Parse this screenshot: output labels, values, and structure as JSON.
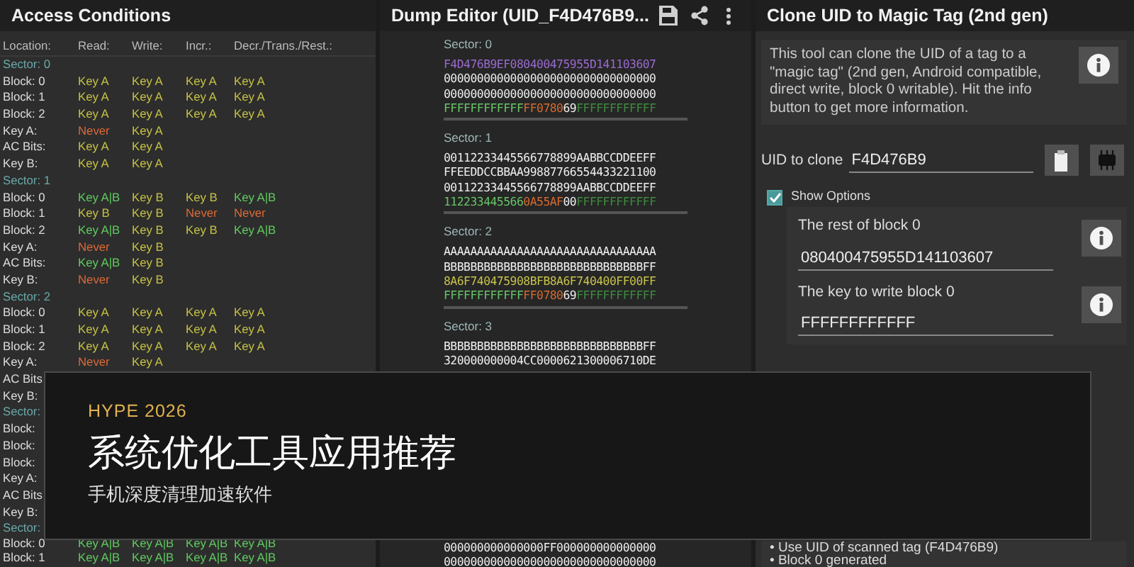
{
  "access_conditions": {
    "title": "Access Conditions",
    "columns": [
      "Location:",
      "Read:",
      "Write:",
      "Incr.:",
      "Decr./Trans./Rest.:"
    ],
    "sectors": [
      {
        "label": "Sector: 0",
        "rows": [
          {
            "label": "Block: 0",
            "cells": [
              {
                "text": "Key A",
                "kind": "single"
              },
              {
                "text": "Key A",
                "kind": "single"
              },
              {
                "text": "Key A",
                "kind": "single"
              },
              {
                "text": "Key A",
                "kind": "single"
              }
            ]
          },
          {
            "label": "Block: 1",
            "cells": [
              {
                "text": "Key A",
                "kind": "single"
              },
              {
                "text": "Key A",
                "kind": "single"
              },
              {
                "text": "Key A",
                "kind": "single"
              },
              {
                "text": "Key A",
                "kind": "single"
              }
            ]
          },
          {
            "label": "Block: 2",
            "cells": [
              {
                "text": "Key A",
                "kind": "single"
              },
              {
                "text": "Key A",
                "kind": "single"
              },
              {
                "text": "Key A",
                "kind": "single"
              },
              {
                "text": "Key A",
                "kind": "single"
              }
            ]
          },
          {
            "label": "Key A:",
            "cells": [
              {
                "text": "Never",
                "kind": "never"
              },
              {
                "text": "Key A",
                "kind": "single"
              }
            ]
          },
          {
            "label": "AC Bits:",
            "cells": [
              {
                "text": "Key A",
                "kind": "single"
              },
              {
                "text": "Key A",
                "kind": "single"
              }
            ]
          },
          {
            "label": "Key B:",
            "cells": [
              {
                "text": "Key A",
                "kind": "single"
              },
              {
                "text": "Key A",
                "kind": "single"
              }
            ]
          }
        ]
      },
      {
        "label": "Sector: 1",
        "rows": [
          {
            "label": "Block: 0",
            "cells": [
              {
                "text": "Key A|B",
                "kind": "both"
              },
              {
                "text": "Key B",
                "kind": "single"
              },
              {
                "text": "Key B",
                "kind": "single"
              },
              {
                "text": "Key A|B",
                "kind": "both"
              }
            ]
          },
          {
            "label": "Block: 1",
            "cells": [
              {
                "text": "Key B",
                "kind": "single"
              },
              {
                "text": "Key B",
                "kind": "single"
              },
              {
                "text": "Never",
                "kind": "never"
              },
              {
                "text": "Never",
                "kind": "never"
              }
            ]
          },
          {
            "label": "Block: 2",
            "cells": [
              {
                "text": "Key A|B",
                "kind": "both"
              },
              {
                "text": "Key B",
                "kind": "single"
              },
              {
                "text": "Key B",
                "kind": "single"
              },
              {
                "text": "Key A|B",
                "kind": "both"
              }
            ]
          },
          {
            "label": "Key A:",
            "cells": [
              {
                "text": "Never",
                "kind": "never"
              },
              {
                "text": "Key B",
                "kind": "single"
              }
            ]
          },
          {
            "label": "AC Bits:",
            "cells": [
              {
                "text": "Key A|B",
                "kind": "both"
              },
              {
                "text": "Key B",
                "kind": "single"
              }
            ]
          },
          {
            "label": "Key B:",
            "cells": [
              {
                "text": "Never",
                "kind": "never"
              },
              {
                "text": "Key B",
                "kind": "single"
              }
            ]
          }
        ]
      },
      {
        "label": "Sector: 2",
        "rows": [
          {
            "label": "Block: 0",
            "cells": [
              {
                "text": "Key A",
                "kind": "single"
              },
              {
                "text": "Key A",
                "kind": "single"
              },
              {
                "text": "Key A",
                "kind": "single"
              },
              {
                "text": "Key A",
                "kind": "single"
              }
            ]
          },
          {
            "label": "Block: 1",
            "cells": [
              {
                "text": "Key A",
                "kind": "single"
              },
              {
                "text": "Key A",
                "kind": "single"
              },
              {
                "text": "Key A",
                "kind": "single"
              },
              {
                "text": "Key A",
                "kind": "single"
              }
            ]
          },
          {
            "label": "Block: 2",
            "cells": [
              {
                "text": "Key A",
                "kind": "single"
              },
              {
                "text": "Key A",
                "kind": "single"
              },
              {
                "text": "Key A",
                "kind": "single"
              },
              {
                "text": "Key A",
                "kind": "single"
              }
            ]
          },
          {
            "label": "Key A:",
            "cells": [
              {
                "text": "Never",
                "kind": "never"
              },
              {
                "text": "Key A",
                "kind": "single"
              }
            ]
          },
          {
            "label": "AC Bits",
            "cells": []
          },
          {
            "label": "Key B:",
            "cells": []
          }
        ]
      },
      {
        "label": "Sector:",
        "rows": [
          {
            "label": "Block:",
            "cells": []
          },
          {
            "label": "Block:",
            "cells": []
          },
          {
            "label": "Block:",
            "cells": []
          },
          {
            "label": "Key A:",
            "cells": []
          },
          {
            "label": "AC Bits",
            "cells": []
          },
          {
            "label": "Key B:",
            "cells": []
          }
        ]
      },
      {
        "label": "Sector:",
        "rows": [
          {
            "label": "Block: 0",
            "cells": [
              {
                "text": "Key A|B",
                "kind": "both"
              },
              {
                "text": "Key A|B",
                "kind": "both"
              },
              {
                "text": "Key A|B",
                "kind": "both"
              },
              {
                "text": "Key A|B",
                "kind": "both"
              }
            ]
          },
          {
            "label": "Block: 1",
            "cells": [
              {
                "text": "Key A|B",
                "kind": "both"
              },
              {
                "text": "Key A|B",
                "kind": "both"
              },
              {
                "text": "Key A|B",
                "kind": "both"
              },
              {
                "text": "Key A|B",
                "kind": "both"
              }
            ]
          }
        ]
      }
    ]
  },
  "dump_editor": {
    "title": "Dump Editor (UID_F4D476B9...",
    "sectors": [
      {
        "label": "Sector: 0",
        "lines": [
          [
            {
              "text": "F4D476B9EF080400475955D141103607",
              "kind": "uid"
            }
          ],
          [
            {
              "text": "00000000000000000000000000000000",
              "kind": "data"
            }
          ],
          [
            {
              "text": "00000000000000000000000000000000",
              "kind": "data"
            }
          ],
          [
            {
              "text": "FFFFFFFFFFFF",
              "kind": "key_a"
            },
            {
              "text": "FF0780",
              "kind": "access"
            },
            {
              "text": "69",
              "kind": "data"
            },
            {
              "text": "FFFFFFFFFFFF",
              "kind": "key_b"
            }
          ]
        ]
      },
      {
        "label": "Sector: 1",
        "lines": [
          [
            {
              "text": "00112233445566778899AABBCCDDEEFF",
              "kind": "data"
            }
          ],
          [
            {
              "text": "FFEEDDCCBBAA99887766554433221100",
              "kind": "data"
            }
          ],
          [
            {
              "text": "00112233445566778899AABBCCDDEEFF",
              "kind": "data"
            }
          ],
          [
            {
              "text": "112233445566",
              "kind": "key_a"
            },
            {
              "text": "0A55AF",
              "kind": "access"
            },
            {
              "text": "00",
              "kind": "data"
            },
            {
              "text": "FFFFFFFFFFFF",
              "kind": "key_b"
            }
          ]
        ]
      },
      {
        "label": "Sector: 2",
        "lines": [
          [
            {
              "text": "AAAAAAAAAAAAAAAAAAAAAAAAAAAAAAAA",
              "kind": "data"
            }
          ],
          [
            {
              "text": "BBBBBBBBBBBBBBBBBBBBBBBBBBBBBBFF",
              "kind": "data"
            }
          ],
          [
            {
              "text": "8A6F740475908BFB8A6F740400FF00FF",
              "kind": "value"
            }
          ],
          [
            {
              "text": "FFFFFFFFFFFF",
              "kind": "key_a"
            },
            {
              "text": "FF0780",
              "kind": "access"
            },
            {
              "text": "69",
              "kind": "data"
            },
            {
              "text": "FFFFFFFFFFFF",
              "kind": "key_b"
            }
          ]
        ]
      },
      {
        "label": "Sector: 3",
        "lines": [
          [
            {
              "text": "BBBBBBBBBBBBBBBBBBBBBBBBBBBBBBFF",
              "kind": "data"
            }
          ],
          [
            {
              "text": "320000000004CC0000621300006710DE",
              "kind": "data"
            }
          ]
        ]
      },
      {
        "lines": [
          [
            {
              "text": "000000000000000FF000000000000000",
              "kind": "data"
            }
          ],
          [
            {
              "text": "00000000000000000000000000000000",
              "kind": "data"
            }
          ]
        ]
      }
    ]
  },
  "clone_tool": {
    "title": "Clone UID to Magic Tag (2nd gen)",
    "description": "This tool can clone the UID of a tag to a \"magic tag\" (2nd gen, Android compatible, direct write, block 0 writable). Hit the info button to get more information.",
    "uid_label": "UID to clone",
    "uid_value": "F4D476B9",
    "show_options": {
      "label": "Show Options",
      "checked": true
    },
    "options": [
      {
        "label": "The rest of block 0",
        "value": "080400475955D141103607"
      },
      {
        "label": "The key to write block 0",
        "value": "FFFFFFFFFFFF"
      }
    ],
    "status_log": [
      "• Use UID of scanned tag (F4D476B9)",
      "• Block 0 generated"
    ]
  },
  "overlay": {
    "eyebrow": "HYPE 2026",
    "title": "系统优化工具应用推荐",
    "subtitle": "手机深度清理加速软件"
  }
}
